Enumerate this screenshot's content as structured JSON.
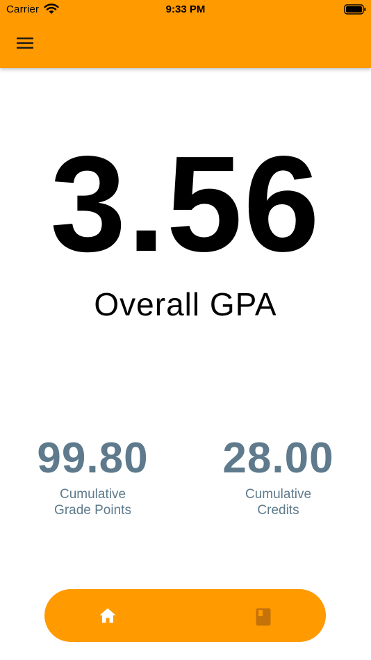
{
  "status_bar": {
    "carrier": "Carrier",
    "time": "9:33 PM",
    "icons": [
      "wifi-icon",
      "battery-icon"
    ]
  },
  "app_bar": {
    "menu_icon": "hamburger-menu-icon",
    "color": "#ff9a00"
  },
  "gpa": {
    "value": "3.56",
    "label": "Overall GPA"
  },
  "stats": {
    "grade_points": {
      "value": "99.80",
      "caption_line1": "Cumulative",
      "caption_line2": "Grade Points"
    },
    "credits": {
      "value": "28.00",
      "caption_line1": "Cumulative",
      "caption_line2": "Credits"
    },
    "color": "#5e7a8c"
  },
  "bottom_nav": {
    "items": [
      {
        "icon": "home-icon",
        "active": true
      },
      {
        "icon": "book-icon",
        "active": false
      }
    ],
    "color": "#ff9a00"
  }
}
